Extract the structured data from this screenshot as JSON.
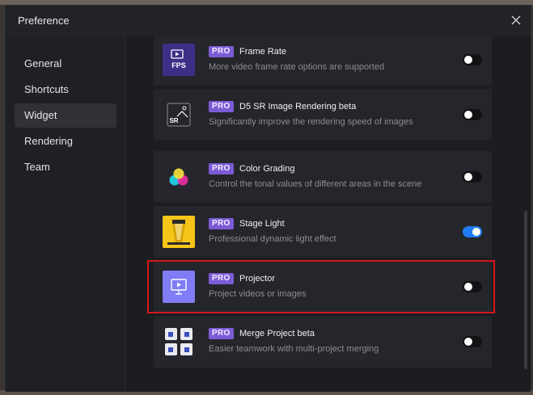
{
  "dialog": {
    "title": "Preference",
    "close_icon": "close-icon"
  },
  "sidebar": {
    "items": [
      {
        "label": "General",
        "active": false
      },
      {
        "label": "Shortcuts",
        "active": false
      },
      {
        "label": "Widget",
        "active": true
      },
      {
        "label": "Rendering",
        "active": false
      },
      {
        "label": "Team",
        "active": false
      }
    ]
  },
  "widgets": [
    {
      "badge": "PRO",
      "title": "Frame Rate",
      "description": "More video frame rate options are supported",
      "icon": "fps-icon",
      "icon_text": "FPS",
      "enabled": false
    },
    {
      "badge": "PRO",
      "title": "D5 SR Image Rendering beta",
      "description": "Significantly improve the rendering speed of images",
      "icon": "sr-image-icon",
      "icon_text": "SR",
      "enabled": false
    },
    {
      "badge": "PRO",
      "title": "Color Grading",
      "description": "Control the tonal values of different areas in the scene",
      "icon": "color-grading-icon",
      "enabled": false
    },
    {
      "badge": "PRO",
      "title": "Stage Light",
      "description": "Professional dynamic light effect",
      "icon": "stage-light-icon",
      "enabled": true
    },
    {
      "badge": "PRO",
      "title": "Projector",
      "description": "Project videos or images",
      "icon": "projector-icon",
      "enabled": false,
      "highlighted": true
    },
    {
      "badge": "PRO",
      "title": "Merge Project beta",
      "description": "Easier teamwork with multi-project merging",
      "icon": "merge-project-icon",
      "enabled": false
    }
  ],
  "colors": {
    "pro_badge": "#7c5bd6",
    "toggle_on": "#1e7cf0",
    "highlight_border": "#d8161b",
    "stage_light_bg": "#f5c518",
    "projector_bg": "#7f7cf5",
    "fps_bg": "#3d2f86"
  }
}
